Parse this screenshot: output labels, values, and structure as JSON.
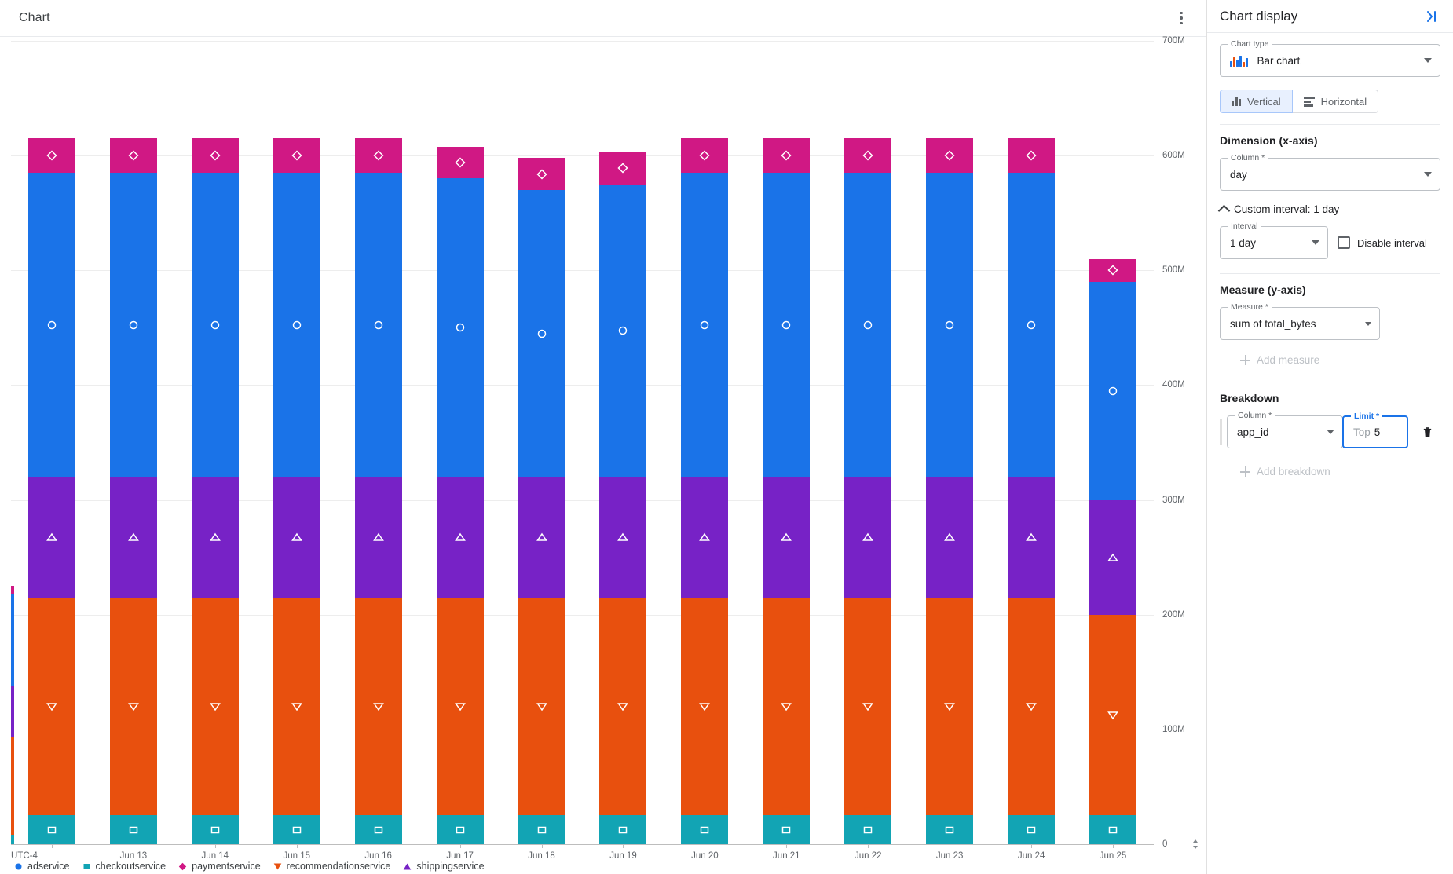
{
  "chart_panel": {
    "title": "Chart",
    "menu_icon": "kebab-menu-icon",
    "scroll_icon": "vertical-scroll-icon"
  },
  "side_panel": {
    "title": "Chart display",
    "collapse_icon": "collapse-panel-icon",
    "chart_type": {
      "label": "Chart type",
      "value": "Bar chart",
      "icon": "bar-chart-icon"
    },
    "orientation": {
      "vertical": "Vertical",
      "horizontal": "Horizontal",
      "selected": "Vertical"
    },
    "dimension": {
      "section": "Dimension (x-axis)",
      "column_label": "Column *",
      "column_value": "day",
      "accordion": "Custom interval: 1 day",
      "interval_label": "Interval",
      "interval_value": "1 day",
      "disable_interval_label": "Disable interval",
      "disable_interval_checked": false
    },
    "measure": {
      "section": "Measure (y-axis)",
      "measure_label": "Measure *",
      "measure_value": "sum of total_bytes",
      "add_measure": "Add measure"
    },
    "breakdown": {
      "section": "Breakdown",
      "column_label": "Column *",
      "column_value": "app_id",
      "limit_label": "Limit *",
      "limit_prefix": "Top",
      "limit_value": "5",
      "delete_icon": "trash-icon",
      "add_breakdown": "Add breakdown"
    }
  },
  "colors": {
    "adservice": "#1a73e8",
    "checkoutservice": "#12a4b4",
    "paymentservice": "#d01884",
    "recommendationservice": "#e8500e",
    "shippingservice": "#7722c6",
    "accent": "#1a73e8",
    "grid": "#ededed",
    "axis": "#bdbdbd"
  },
  "chart_data": {
    "type": "bar",
    "stacked": true,
    "title": "Chart",
    "xlabel": "",
    "ylabel": "",
    "grid": true,
    "legend_position": "bottom-left",
    "y_axis_side": "right",
    "ylim": [
      0,
      700000000
    ],
    "ytick_labels": [
      "0",
      "100M",
      "200M",
      "300M",
      "400M",
      "500M",
      "600M",
      "700M"
    ],
    "ytick_values": [
      0,
      100000000,
      200000000,
      300000000,
      400000000,
      500000000,
      600000000,
      700000000
    ],
    "x_axis_note": "UTC-4",
    "categories": [
      "UTC-4",
      "Jun 13",
      "Jun 14",
      "Jun 15",
      "Jun 16",
      "Jun 17",
      "Jun 18",
      "Jun 19",
      "Jun 20",
      "Jun 21",
      "Jun 22",
      "Jun 23",
      "Jun 24",
      "Jun 25"
    ],
    "partial_leading_bar": {
      "present": true,
      "note": "thin clipped bar at left edge",
      "values": [
        8000000,
        85000000,
        45000000,
        80000000,
        7000000
      ]
    },
    "series": [
      {
        "name": "checkoutservice",
        "color": "#12a4b4",
        "marker": "square",
        "values": [
          25000000,
          25000000,
          25000000,
          25000000,
          25000000,
          25000000,
          25000000,
          25000000,
          25000000,
          25000000,
          25000000,
          25000000,
          25000000,
          25000000
        ]
      },
      {
        "name": "recommendationservice",
        "color": "#e8500e",
        "marker": "triangle-down",
        "values": [
          190000000,
          190000000,
          190000000,
          190000000,
          190000000,
          190000000,
          190000000,
          190000000,
          190000000,
          190000000,
          190000000,
          190000000,
          190000000,
          175000000
        ]
      },
      {
        "name": "shippingservice",
        "color": "#7722c6",
        "marker": "triangle-up",
        "values": [
          105000000,
          105000000,
          105000000,
          105000000,
          105000000,
          105000000,
          105000000,
          105000000,
          105000000,
          105000000,
          105000000,
          105000000,
          105000000,
          100000000
        ]
      },
      {
        "name": "adservice",
        "color": "#1a73e8",
        "marker": "circle",
        "values": [
          265000000,
          265000000,
          265000000,
          265000000,
          265000000,
          260000000,
          250000000,
          255000000,
          265000000,
          265000000,
          265000000,
          265000000,
          265000000,
          190000000
        ]
      },
      {
        "name": "paymentservice",
        "color": "#d01884",
        "marker": "diamond",
        "values": [
          30000000,
          30000000,
          30000000,
          30000000,
          30000000,
          28000000,
          28000000,
          28000000,
          30000000,
          30000000,
          30000000,
          30000000,
          30000000,
          20000000
        ]
      }
    ],
    "totals": [
      615000000,
      615000000,
      615000000,
      615000000,
      615000000,
      608000000,
      598000000,
      603000000,
      615000000,
      615000000,
      615000000,
      615000000,
      615000000,
      510000000
    ],
    "legend": [
      {
        "label": "adservice",
        "color": "#1a73e8",
        "marker": "circle"
      },
      {
        "label": "checkoutservice",
        "color": "#12a4b4",
        "marker": "square"
      },
      {
        "label": "paymentservice",
        "color": "#d01884",
        "marker": "diamond"
      },
      {
        "label": "recommendationservice",
        "color": "#e8500e",
        "marker": "triangle-down"
      },
      {
        "label": "shippingservice",
        "color": "#7722c6",
        "marker": "triangle-up"
      }
    ]
  }
}
